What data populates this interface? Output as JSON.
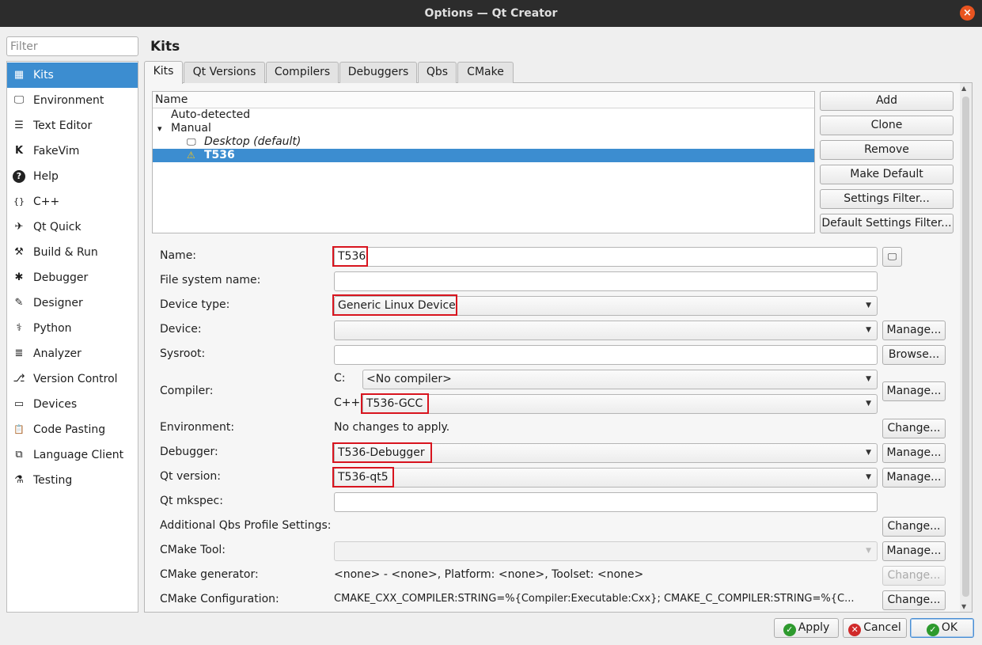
{
  "window": {
    "title": "Options — Qt Creator",
    "close_glyph": "×"
  },
  "filter": {
    "placeholder": "Filter"
  },
  "sidebar": {
    "items": [
      {
        "label": "Kits",
        "icon": "kits-icon",
        "glyph": "▦"
      },
      {
        "label": "Environment",
        "icon": "monitor-icon",
        "glyph": "🖵"
      },
      {
        "label": "Text Editor",
        "icon": "text-editor-icon",
        "glyph": "☰"
      },
      {
        "label": "FakeVim",
        "icon": "fakevim-icon",
        "glyph": "K"
      },
      {
        "label": "Help",
        "icon": "help-icon",
        "glyph": "?"
      },
      {
        "label": "C++",
        "icon": "cpp-braces-icon",
        "glyph": "{}"
      },
      {
        "label": "Qt Quick",
        "icon": "qt-quick-icon",
        "glyph": "✈"
      },
      {
        "label": "Build & Run",
        "icon": "hammer-icon",
        "glyph": "⚒"
      },
      {
        "label": "Debugger",
        "icon": "bug-icon",
        "glyph": "✱"
      },
      {
        "label": "Designer",
        "icon": "pencil-icon",
        "glyph": "✎"
      },
      {
        "label": "Python",
        "icon": "python-icon",
        "glyph": "⚕"
      },
      {
        "label": "Analyzer",
        "icon": "analyzer-icon",
        "glyph": "≣"
      },
      {
        "label": "Version Control",
        "icon": "version-control-icon",
        "glyph": "⎇"
      },
      {
        "label": "Devices",
        "icon": "devices-icon",
        "glyph": "▭"
      },
      {
        "label": "Code Pasting",
        "icon": "clipboard-icon",
        "glyph": "📋"
      },
      {
        "label": "Language Client",
        "icon": "language-client-icon",
        "glyph": "⧉"
      },
      {
        "label": "Testing",
        "icon": "testing-icon",
        "glyph": "⚗"
      }
    ]
  },
  "page": {
    "title": "Kits"
  },
  "tabs": [
    "Kits",
    "Qt Versions",
    "Compilers",
    "Debuggers",
    "Qbs",
    "CMake"
  ],
  "tree": {
    "header": "Name",
    "rows": [
      {
        "label": "Auto-detected"
      },
      {
        "label": "Manual",
        "toggle": "▾"
      },
      {
        "label": "Desktop (default)",
        "icon": "desktop-icon",
        "glyph": "🖵"
      },
      {
        "label": "T536",
        "icon": "warning-icon",
        "glyph": "⚠"
      }
    ]
  },
  "kit_buttons": [
    "Add",
    "Clone",
    "Remove",
    "Make Default",
    "Settings Filter...",
    "Default Settings Filter..."
  ],
  "form": {
    "name": {
      "label": "Name:",
      "value": "T536",
      "icon_glyph": "🖵"
    },
    "fs_name": {
      "label": "File system name:",
      "value": ""
    },
    "device_type": {
      "label": "Device type:",
      "value": "Generic Linux Device"
    },
    "device": {
      "label": "Device:",
      "value": "",
      "button": "Manage..."
    },
    "sysroot": {
      "label": "Sysroot:",
      "value": "",
      "button": "Browse..."
    },
    "compiler": {
      "label": "Compiler:",
      "c_label": "C:",
      "c_value": "<No compiler>",
      "cpp_label": "C++:",
      "cpp_value": "T536-GCC",
      "button": "Manage..."
    },
    "environment": {
      "label": "Environment:",
      "value": "No changes to apply.",
      "button": "Change..."
    },
    "debugger": {
      "label": "Debugger:",
      "value": "T536-Debugger",
      "button": "Manage..."
    },
    "qt_version": {
      "label": "Qt version:",
      "value": "T536-qt5",
      "button": "Manage..."
    },
    "qt_mkspec": {
      "label": "Qt mkspec:",
      "value": ""
    },
    "qbs": {
      "label": "Additional Qbs Profile Settings:",
      "button": "Change..."
    },
    "cmake_tool": {
      "label": "CMake Tool:",
      "value": "",
      "button": "Manage..."
    },
    "cmake_generator": {
      "label": "CMake generator:",
      "value": "<none> - <none>, Platform: <none>, Toolset: <none>",
      "button": "Change..."
    },
    "cmake_config": {
      "label": "CMake Configuration:",
      "value": "CMAKE_CXX_COMPILER:STRING=%{Compiler:Executable:Cxx}; CMAKE_C_COMPILER:STRING=%{C...",
      "button": "Change..."
    }
  },
  "footer": {
    "apply": {
      "label": "Apply",
      "glyph": "✓"
    },
    "cancel": {
      "label": "Cancel",
      "glyph": "✕"
    },
    "ok": {
      "label": "OK",
      "glyph": "✓"
    }
  },
  "colors": {
    "selection": "#3c8dd0",
    "highlight_box": "#d8141e",
    "titlebar": "#2c2c2c",
    "close_button": "#e95420",
    "ok_icon": "#2e9a2e",
    "cancel_icon": "#d02a2a"
  }
}
